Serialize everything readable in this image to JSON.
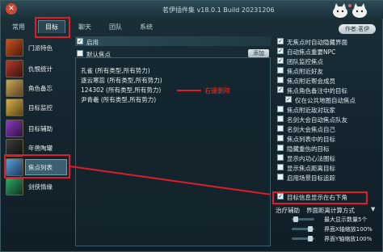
{
  "window": {
    "title": "茗伊插件集 v18.0.1 Build 20231206",
    "close_glyph": "✕",
    "author_button": "作者:茗伊"
  },
  "tabs": [
    {
      "label": "常用"
    },
    {
      "label": "目标",
      "active": true
    },
    {
      "label": "聊天"
    },
    {
      "label": "团队"
    },
    {
      "label": "系统"
    }
  ],
  "sidebar": {
    "items": [
      {
        "label": "门派特色",
        "icon": "flame-icon"
      },
      {
        "label": "仇恨统计",
        "icon": "claw-icon"
      },
      {
        "label": "角色备忘",
        "icon": "book-icon"
      },
      {
        "label": "目标监控",
        "icon": "crown-icon"
      },
      {
        "label": "目标辅助",
        "icon": "spiral-icon"
      },
      {
        "label": "年兽陶罐",
        "icon": "jar-icon"
      },
      {
        "label": "焦点列表",
        "icon": "list-icon",
        "active": true
      },
      {
        "label": "剑侠情缘",
        "icon": "sword-icon"
      }
    ]
  },
  "main": {
    "enable_label": "启用",
    "default_focus_label": "默认焦点",
    "add_button": "添加",
    "list": [
      "孔雀 (所有类型,所有势力)",
      "逐云寒蕊 (所有类型,所有势力)",
      "124302 (所有类型,所有势力)",
      "尹青羲 (所有类型,所有势力)"
    ],
    "annotation": "右键删除"
  },
  "options": [
    {
      "label": "无焦点时自动隐藏界面",
      "checked": true
    },
    {
      "label": "自动焦点重要NPC",
      "checked": true
    },
    {
      "label": "团队监控焦点",
      "checked": true
    },
    {
      "label": "焦点附近好友",
      "checked": false
    },
    {
      "label": "焦点附近帮会成员",
      "checked": false
    },
    {
      "label": "焦点角色备注中的目标",
      "checked": true
    },
    {
      "label": "仅在公共地图自动焦点",
      "checked": true,
      "indent": true
    },
    {
      "label": "焦点附近敌对玩家",
      "checked": false
    },
    {
      "label": "名剑大会自动焦点队友",
      "checked": false
    },
    {
      "label": "名剑大会焦点自己",
      "checked": false
    },
    {
      "label": "焦点列表中的目标",
      "checked": false
    },
    {
      "label": "隐藏重伤的目标",
      "checked": false
    },
    {
      "label": "显示内功心法图标",
      "checked": false
    },
    {
      "label": "显示焦点距离目标",
      "checked": false
    },
    {
      "label": "启用场景目标追踪",
      "checked": false
    },
    {
      "label": "目标信息显示在右下角",
      "checked": true,
      "highlighted": true
    }
  ],
  "bottom_controls": {
    "treat_label": "治疗辅助",
    "distance_mode": "界面距离计算方式",
    "max_display": "最大显示数量5个",
    "x_scale": "界面X轴缩放100%",
    "y_scale": "界面Y轴缩放100%"
  },
  "colors": {
    "highlight": "#e01c2a",
    "accent": "#3b6170"
  }
}
